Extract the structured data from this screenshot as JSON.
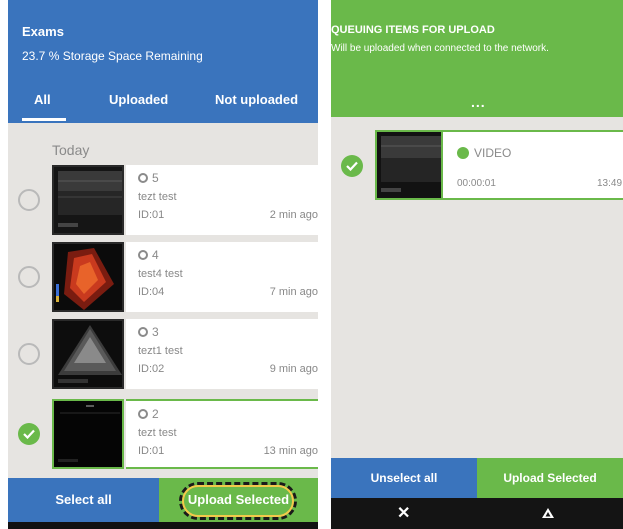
{
  "left": {
    "header": {
      "title": "Exams",
      "storage": "23.7 % Storage Space Remaining"
    },
    "tabs": [
      {
        "label": "All",
        "active": true
      },
      {
        "label": "Uploaded",
        "active": false
      },
      {
        "label": "Not uploaded",
        "active": false
      }
    ],
    "section_label": "Today",
    "items": [
      {
        "number": "5",
        "name": "tezt test",
        "id": "ID:01",
        "ago": "2 min ago",
        "selected": false,
        "thumb": "ultrasound-gray-icon"
      },
      {
        "number": "4",
        "name": "test4 test",
        "id": "ID:04",
        "ago": "7 min ago",
        "selected": false,
        "thumb": "doppler-red-icon"
      },
      {
        "number": "3",
        "name": "tezt1 test",
        "id": "ID:02",
        "ago": "9 min ago",
        "selected": false,
        "thumb": "ultrasound-cone-icon"
      },
      {
        "number": "2",
        "name": "tezt test",
        "id": "ID:01",
        "ago": "13 min ago",
        "selected": true,
        "thumb": "ultrasound-dark-icon"
      }
    ],
    "footer": {
      "select_all": "Select all",
      "upload_selected": "Upload Selected"
    }
  },
  "right": {
    "header": {
      "title": "QUEUING ITEMS FOR UPLOAD",
      "subtitle": "Will be uploaded when connected to the network.",
      "more": "..."
    },
    "item": {
      "type_label": "VIDEO",
      "duration": "00:00:01",
      "time": "13:49"
    },
    "footer": {
      "unselect_all": "Unselect all",
      "upload_selected": "Upload Selected"
    },
    "nav": {
      "close": "✕"
    }
  },
  "colors": {
    "blue": "#3a74bd",
    "green": "#6ab94a",
    "background": "#e6e4e1"
  }
}
